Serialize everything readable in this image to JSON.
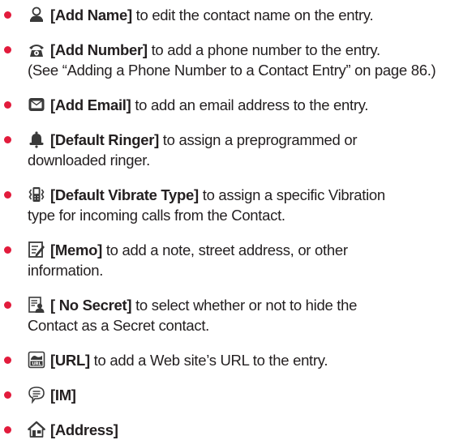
{
  "colors": {
    "bullet": "#e21b3c",
    "text": "#231f20",
    "icon": "#3a3a3a"
  },
  "items": [
    {
      "icon": "person-icon",
      "label": "[Add Name]",
      "text": " to edit the contact name on the entry.",
      "text2": ""
    },
    {
      "icon": "telephone-icon",
      "label": "[Add Number]",
      "text": " to add a phone number to the entry.",
      "text2": "(See “Adding a Phone Number to a Contact Entry” on page 86.)"
    },
    {
      "icon": "email-icon",
      "label": "[Add Email]",
      "text": " to add an email address to the entry.",
      "text2": ""
    },
    {
      "icon": "bell-icon",
      "label": "[Default Ringer]",
      "text": " to assign a preprogrammed or",
      "text2": "downloaded ringer."
    },
    {
      "icon": "vibrate-icon",
      "label": "[Default Vibrate Type]",
      "text": " to assign a specific Vibration",
      "text2": "type for incoming calls from the Contact."
    },
    {
      "icon": "memo-icon",
      "label": "[Memo]",
      "text": " to add a note, street address, or other",
      "text2": "information."
    },
    {
      "icon": "secret-icon",
      "label": "[ No Secret]",
      "text": " to select whether or not to hide the",
      "text2": "Contact as a Secret contact."
    },
    {
      "icon": "url-icon",
      "label": "[URL]",
      "text": " to add a Web site’s URL to the entry.",
      "text2": ""
    },
    {
      "icon": "chat-bubble-icon",
      "label": "[IM]",
      "text": "",
      "text2": ""
    },
    {
      "icon": "house-icon",
      "label": "[Address]",
      "text": "",
      "text2": ""
    }
  ]
}
